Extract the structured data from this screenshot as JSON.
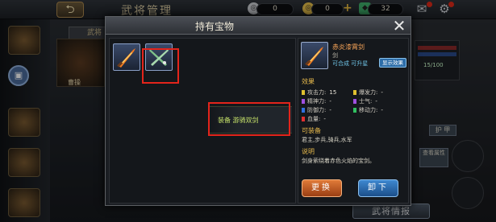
{
  "screen": {
    "title": "武将管理",
    "currency_1_value": "0",
    "currency_2_value": "0",
    "currency_3_value": "32",
    "tab_left_label": "武将",
    "general_name": "曹操",
    "bottom_button_label": "武将情报",
    "right_rail": {
      "exp_text": "15/100",
      "btn_label": "护 甲",
      "btn2_label": "查看属性"
    }
  },
  "modal": {
    "title": "持有宝物",
    "equip_label": "装备 游骑双剑",
    "detail": {
      "name": "赤炎漆霄剑",
      "type": "剑",
      "meta": "可合成  可升星",
      "show_effect_label": "显示效果",
      "effects_title": "效果",
      "stats": [
        {
          "label": "攻击力:",
          "value": "15",
          "color": "#e0c030"
        },
        {
          "label": "爆发力:",
          "value": "-",
          "color": "#e0c030"
        },
        {
          "label": "精神力:",
          "value": "-",
          "color": "#a050e0"
        },
        {
          "label": "士气:",
          "value": "-",
          "color": "#a050e0"
        },
        {
          "label": "防御力:",
          "value": "-",
          "color": "#3070e0"
        },
        {
          "label": "移动力:",
          "value": "-",
          "color": "#30c060"
        },
        {
          "label": "血量:",
          "value": "-",
          "color": "#e03030"
        }
      ],
      "equippable_title": "可装备",
      "equippable_text": "君主,步兵,骑兵,水军",
      "description_title": "说明",
      "description_text": "剑身萦绕着赤色火焰的宝剑。"
    },
    "swap_label": "更换",
    "unequip_label": "卸下"
  }
}
